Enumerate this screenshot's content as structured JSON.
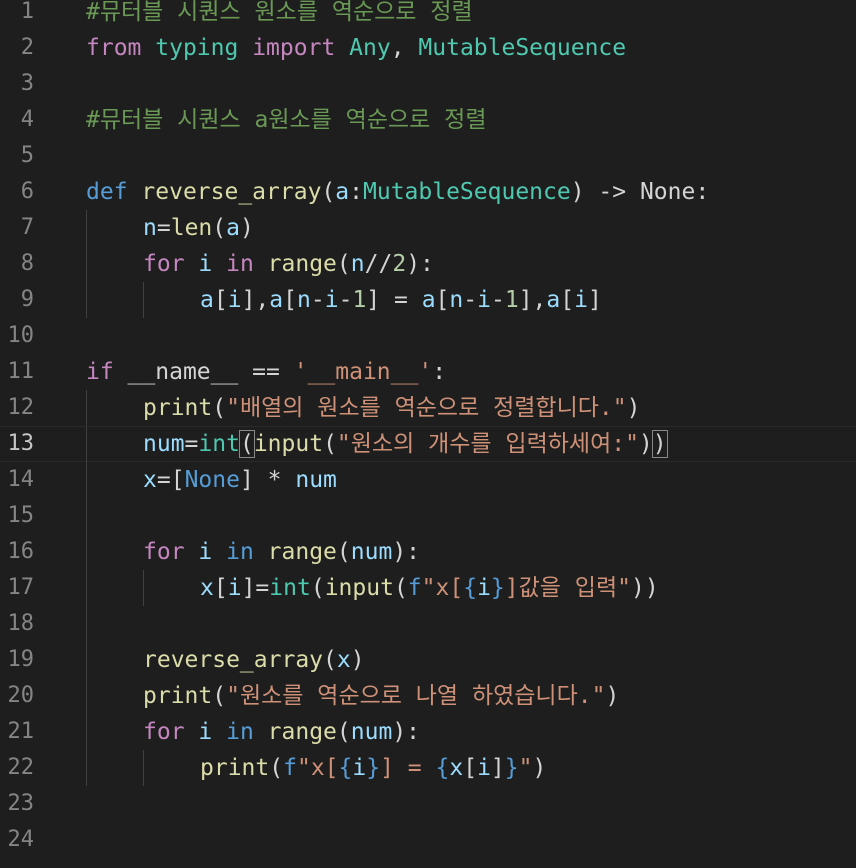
{
  "editor": {
    "lines": [
      {
        "n": "1",
        "tokens": [
          {
            "t": "#뮤터블 시퀀스 원소를 역순으로 정렬",
            "c": "comment"
          }
        ]
      },
      {
        "n": "2",
        "tokens": [
          {
            "t": "from",
            "c": "kw"
          },
          {
            "t": " ",
            "c": "punc"
          },
          {
            "t": "typing",
            "c": "mod"
          },
          {
            "t": " ",
            "c": "punc"
          },
          {
            "t": "import",
            "c": "kw"
          },
          {
            "t": " ",
            "c": "punc"
          },
          {
            "t": "Any",
            "c": "type"
          },
          {
            "t": ", ",
            "c": "punc"
          },
          {
            "t": "MutableSequence",
            "c": "type"
          }
        ]
      },
      {
        "n": "3",
        "tokens": []
      },
      {
        "n": "4",
        "tokens": [
          {
            "t": "#뮤터블 시퀀스 a원소를 역순으로 정렬",
            "c": "comment"
          }
        ]
      },
      {
        "n": "5",
        "tokens": []
      },
      {
        "n": "6",
        "tokens": [
          {
            "t": "def",
            "c": "def"
          },
          {
            "t": " ",
            "c": "punc"
          },
          {
            "t": "reverse_array",
            "c": "fn"
          },
          {
            "t": "(",
            "c": "punc"
          },
          {
            "t": "a",
            "c": "var"
          },
          {
            "t": ":",
            "c": "punc"
          },
          {
            "t": "MutableSequence",
            "c": "type"
          },
          {
            "t": ") -> None:",
            "c": "punc"
          }
        ]
      },
      {
        "n": "7",
        "indent": 1,
        "tokens": [
          {
            "t": "n",
            "c": "var"
          },
          {
            "t": "=",
            "c": "punc"
          },
          {
            "t": "len",
            "c": "fn"
          },
          {
            "t": "(",
            "c": "punc"
          },
          {
            "t": "a",
            "c": "var"
          },
          {
            "t": ")",
            "c": "punc"
          }
        ]
      },
      {
        "n": "8",
        "indent": 1,
        "tokens": [
          {
            "t": "for",
            "c": "kw"
          },
          {
            "t": " ",
            "c": "punc"
          },
          {
            "t": "i",
            "c": "var"
          },
          {
            "t": " in ",
            "c": "kw"
          },
          {
            "t": "range",
            "c": "fn"
          },
          {
            "t": "(",
            "c": "punc"
          },
          {
            "t": "n",
            "c": "var"
          },
          {
            "t": "//",
            "c": "punc"
          },
          {
            "t": "2",
            "c": "num"
          },
          {
            "t": "):",
            "c": "punc"
          }
        ]
      },
      {
        "n": "9",
        "indent": 2,
        "tokens": [
          {
            "t": "a",
            "c": "var"
          },
          {
            "t": "[",
            "c": "punc"
          },
          {
            "t": "i",
            "c": "var"
          },
          {
            "t": "],",
            "c": "punc"
          },
          {
            "t": "a",
            "c": "var"
          },
          {
            "t": "[",
            "c": "punc"
          },
          {
            "t": "n",
            "c": "var"
          },
          {
            "t": "-",
            "c": "punc"
          },
          {
            "t": "i",
            "c": "var"
          },
          {
            "t": "-",
            "c": "punc"
          },
          {
            "t": "1",
            "c": "num"
          },
          {
            "t": "] = ",
            "c": "punc"
          },
          {
            "t": "a",
            "c": "var"
          },
          {
            "t": "[",
            "c": "punc"
          },
          {
            "t": "n",
            "c": "var"
          },
          {
            "t": "-",
            "c": "punc"
          },
          {
            "t": "i",
            "c": "var"
          },
          {
            "t": "-",
            "c": "punc"
          },
          {
            "t": "1",
            "c": "num"
          },
          {
            "t": "],",
            "c": "punc"
          },
          {
            "t": "a",
            "c": "var"
          },
          {
            "t": "[",
            "c": "punc"
          },
          {
            "t": "i",
            "c": "var"
          },
          {
            "t": "]",
            "c": "punc"
          }
        ]
      },
      {
        "n": "10",
        "tokens": []
      },
      {
        "n": "11",
        "tokens": [
          {
            "t": "if",
            "c": "kw"
          },
          {
            "t": " __name__ == ",
            "c": "punc"
          },
          {
            "t": "'__main__'",
            "c": "str"
          },
          {
            "t": ":",
            "c": "punc"
          }
        ]
      },
      {
        "n": "12",
        "indent": 1,
        "tokens": [
          {
            "t": "print",
            "c": "fn"
          },
          {
            "t": "(",
            "c": "punc"
          },
          {
            "t": "\"배열의 원소를 역순으로 정렬합니다.\"",
            "c": "str"
          },
          {
            "t": ")",
            "c": "punc"
          }
        ]
      },
      {
        "n": "13",
        "indent": 1,
        "current": true,
        "tokens": [
          {
            "t": "num",
            "c": "var"
          },
          {
            "t": "=",
            "c": "punc"
          },
          {
            "t": "int",
            "c": "type"
          },
          {
            "t": "(",
            "c": "punc",
            "match": true
          },
          {
            "t": "input",
            "c": "fn"
          },
          {
            "t": "(",
            "c": "punc"
          },
          {
            "t": "\"원소의 개수를 입력하세여:\"",
            "c": "str"
          },
          {
            "t": ")",
            "c": "punc"
          },
          {
            "t": ")",
            "c": "punc",
            "match": true
          }
        ]
      },
      {
        "n": "14",
        "indent": 1,
        "tokens": [
          {
            "t": "x",
            "c": "var"
          },
          {
            "t": "=[",
            "c": "punc"
          },
          {
            "t": "None",
            "c": "const"
          },
          {
            "t": "] * ",
            "c": "punc"
          },
          {
            "t": "num",
            "c": "var"
          }
        ]
      },
      {
        "n": "15",
        "indent": 1,
        "tokens": []
      },
      {
        "n": "16",
        "indent": 1,
        "tokens": [
          {
            "t": "for",
            "c": "kw"
          },
          {
            "t": " ",
            "c": "punc"
          },
          {
            "t": "i",
            "c": "var"
          },
          {
            "t": " in ",
            "c": "def"
          },
          {
            "t": "range",
            "c": "fn"
          },
          {
            "t": "(",
            "c": "punc"
          },
          {
            "t": "num",
            "c": "var"
          },
          {
            "t": "):",
            "c": "punc"
          }
        ]
      },
      {
        "n": "17",
        "indent": 2,
        "tokens": [
          {
            "t": "x",
            "c": "var"
          },
          {
            "t": "[",
            "c": "punc"
          },
          {
            "t": "i",
            "c": "var"
          },
          {
            "t": "]=",
            "c": "punc"
          },
          {
            "t": "int",
            "c": "type"
          },
          {
            "t": "(",
            "c": "punc"
          },
          {
            "t": "input",
            "c": "fn"
          },
          {
            "t": "(",
            "c": "punc"
          },
          {
            "t": "f",
            "c": "def"
          },
          {
            "t": "\"x[",
            "c": "str"
          },
          {
            "t": "{",
            "c": "brace"
          },
          {
            "t": "i",
            "c": "var"
          },
          {
            "t": "}",
            "c": "brace"
          },
          {
            "t": "]값을 입력\"",
            "c": "str"
          },
          {
            "t": "))",
            "c": "punc"
          }
        ]
      },
      {
        "n": "18",
        "indent": 1,
        "tokens": []
      },
      {
        "n": "19",
        "indent": 1,
        "tokens": [
          {
            "t": "reverse_array",
            "c": "fn"
          },
          {
            "t": "(",
            "c": "punc"
          },
          {
            "t": "x",
            "c": "var"
          },
          {
            "t": ")",
            "c": "punc"
          }
        ]
      },
      {
        "n": "20",
        "indent": 1,
        "tokens": [
          {
            "t": "print",
            "c": "fn"
          },
          {
            "t": "(",
            "c": "punc"
          },
          {
            "t": "\"원소를 역순으로 나열 하였습니다.\"",
            "c": "str"
          },
          {
            "t": ")",
            "c": "punc"
          }
        ]
      },
      {
        "n": "21",
        "indent": 1,
        "tokens": [
          {
            "t": "for",
            "c": "kw"
          },
          {
            "t": " ",
            "c": "punc"
          },
          {
            "t": "i",
            "c": "var"
          },
          {
            "t": " in ",
            "c": "def"
          },
          {
            "t": "range",
            "c": "fn"
          },
          {
            "t": "(",
            "c": "punc"
          },
          {
            "t": "num",
            "c": "var"
          },
          {
            "t": "):",
            "c": "punc"
          }
        ]
      },
      {
        "n": "22",
        "indent": 2,
        "tokens": [
          {
            "t": "print",
            "c": "fn"
          },
          {
            "t": "(",
            "c": "punc"
          },
          {
            "t": "f",
            "c": "def"
          },
          {
            "t": "\"x[",
            "c": "str"
          },
          {
            "t": "{",
            "c": "brace"
          },
          {
            "t": "i",
            "c": "var"
          },
          {
            "t": "}",
            "c": "brace"
          },
          {
            "t": "] = ",
            "c": "str"
          },
          {
            "t": "{",
            "c": "brace"
          },
          {
            "t": "x",
            "c": "var"
          },
          {
            "t": "[",
            "c": "punc"
          },
          {
            "t": "i",
            "c": "var"
          },
          {
            "t": "]",
            "c": "punc"
          },
          {
            "t": "}",
            "c": "brace"
          },
          {
            "t": "\"",
            "c": "str"
          },
          {
            "t": ")",
            "c": "punc"
          }
        ]
      },
      {
        "n": "23",
        "tokens": []
      },
      {
        "n": "24",
        "tokens": []
      }
    ],
    "current_line": "13"
  }
}
